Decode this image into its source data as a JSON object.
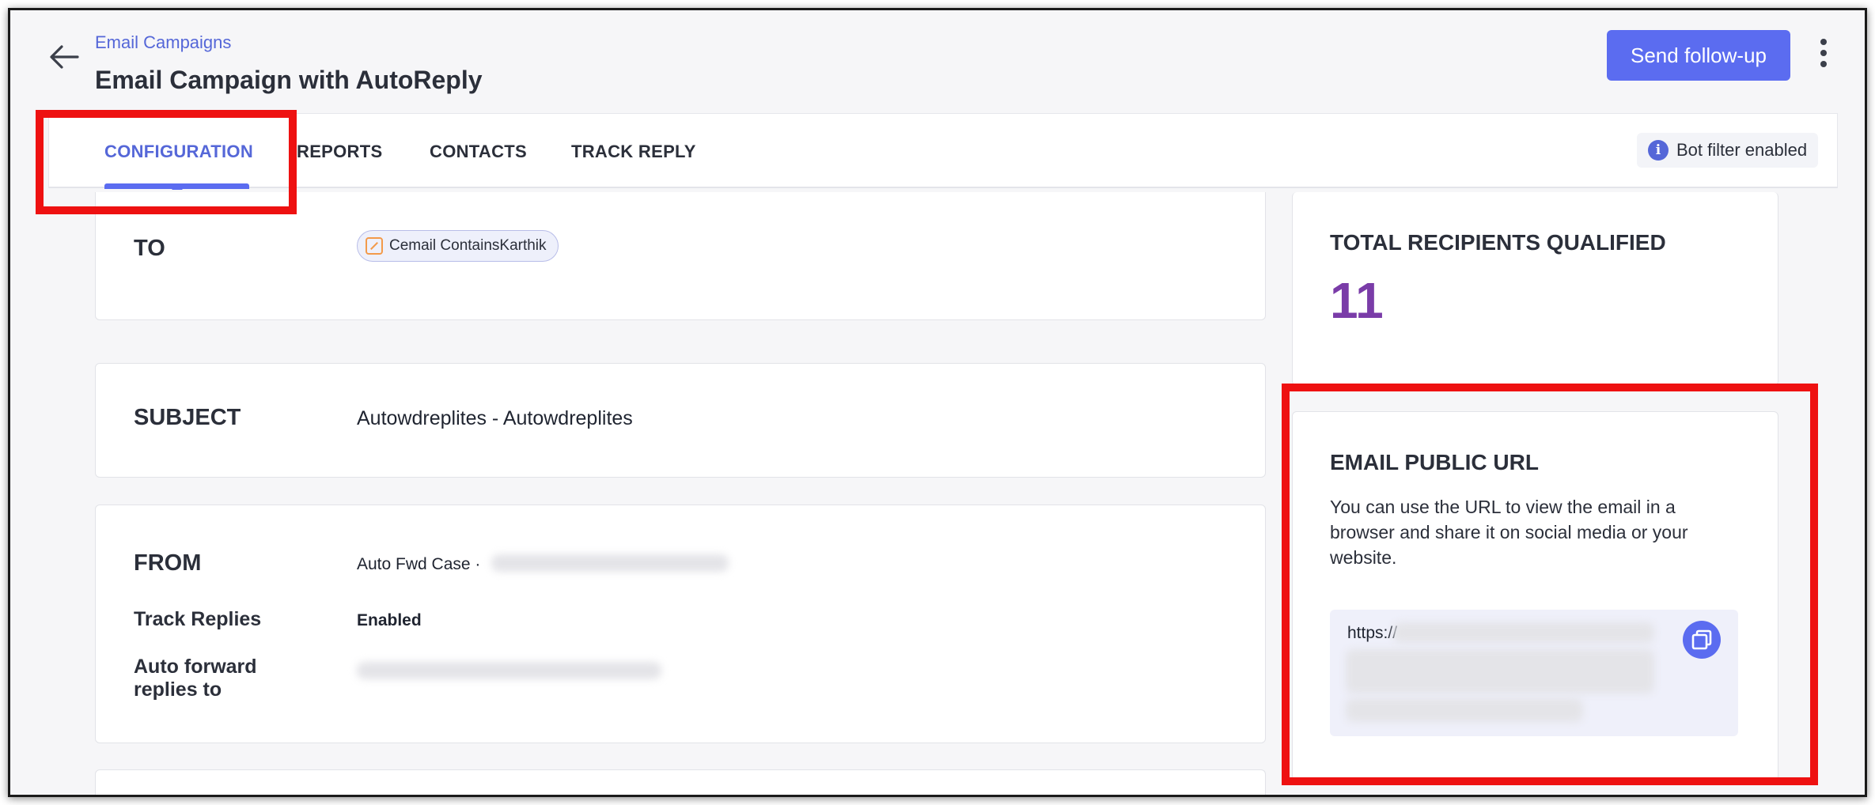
{
  "header": {
    "breadcrumb": "Email Campaigns",
    "title": "Email Campaign with AutoReply",
    "send_button": "Send follow-up"
  },
  "tabs": [
    {
      "label": "CONFIGURATION",
      "active": true
    },
    {
      "label": "REPORTS",
      "active": false
    },
    {
      "label": "CONTACTS",
      "active": false
    },
    {
      "label": "TRACK REPLY",
      "active": false
    }
  ],
  "bot_filter": {
    "icon": "info-icon",
    "label": "Bot filter enabled"
  },
  "to": {
    "label": "TO",
    "chip": "Cemail ContainsKarthik"
  },
  "subject": {
    "label": "SUBJECT",
    "value": "Autowdreplites - Autowdreplites"
  },
  "from": {
    "label": "FROM",
    "value": "Auto Fwd Case ·",
    "track_replies_label": "Track Replies",
    "track_replies_value": "Enabled",
    "auto_forward_label_1": "Auto forward",
    "auto_forward_label_2": "replies to"
  },
  "recipients": {
    "title": "TOTAL RECIPIENTS QUALIFIED",
    "count": "11"
  },
  "public_url": {
    "title": "EMAIL PUBLIC URL",
    "description": "You can use the URL to view the email in a browser and share it on social media or your website.",
    "url_prefix": "https://"
  },
  "colors": {
    "accent": "#5b6cf0",
    "count": "#7a3ca8",
    "highlight": "#ee1111"
  }
}
